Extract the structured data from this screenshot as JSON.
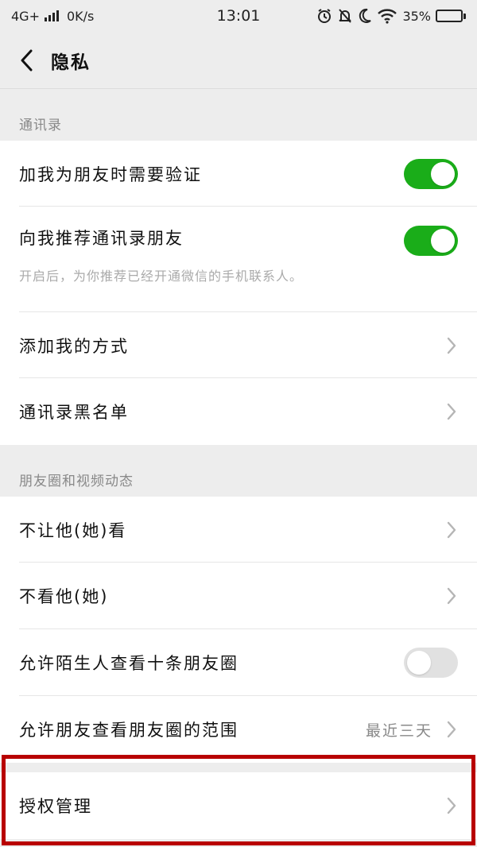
{
  "status_bar": {
    "network": "4G+",
    "speed": "0K/s",
    "time": "13:01",
    "battery": "35%",
    "battery_level": 0.35
  },
  "nav": {
    "title": "隐私"
  },
  "sections": {
    "contacts": {
      "header": "通讯录",
      "items": [
        {
          "label": "加我为朋友时需要验证",
          "toggle": true
        },
        {
          "label": "向我推荐通讯录朋友",
          "toggle": true,
          "description": "开启后，为你推荐已经开通微信的手机联系人。"
        },
        {
          "label": "添加我的方式"
        },
        {
          "label": "通讯录黑名单"
        }
      ]
    },
    "moments": {
      "header": "朋友圈和视频动态",
      "items": [
        {
          "label": "不让他(她)看"
        },
        {
          "label": "不看他(她)"
        },
        {
          "label": "允许陌生人查看十条朋友圈",
          "toggle": false
        },
        {
          "label": "允许朋友查看朋友圈的范围",
          "value": "最近三天"
        }
      ]
    },
    "auth": {
      "items": [
        {
          "label": "授权管理"
        }
      ]
    }
  },
  "colors": {
    "toggle_on": "#1aad19",
    "toggle_off": "#e1e1e1",
    "highlight": "#b80000"
  }
}
